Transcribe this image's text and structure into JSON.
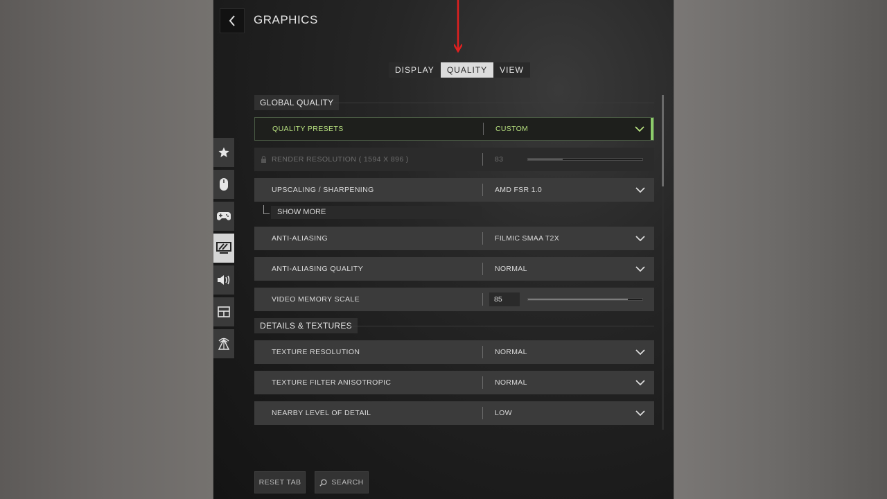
{
  "header": {
    "title": "GRAPHICS"
  },
  "tabs": [
    {
      "label": "DISPLAY",
      "active": false
    },
    {
      "label": "QUALITY",
      "active": true
    },
    {
      "label": "VIEW",
      "active": false
    }
  ],
  "sections": {
    "global": "GLOBAL QUALITY",
    "details": "DETAILS & TEXTURES"
  },
  "rows": {
    "quality_presets": {
      "label": "QUALITY PRESETS",
      "value": "CUSTOM"
    },
    "render_resolution": {
      "label": "RENDER RESOLUTION ( 1594 X 896 )",
      "value": "83",
      "level_percent": 30
    },
    "upscaling": {
      "label": "UPSCALING / SHARPENING",
      "value": "AMD FSR 1.0"
    },
    "show_more": "SHOW MORE",
    "anti_aliasing": {
      "label": "ANTI-ALIASING",
      "value": "FILMIC SMAA T2X"
    },
    "anti_aliasing_quality": {
      "label": "ANTI-ALIASING QUALITY",
      "value": "NORMAL"
    },
    "video_memory_scale": {
      "label": "VIDEO MEMORY SCALE",
      "value": "85",
      "level_percent": 87
    },
    "texture_resolution": {
      "label": "TEXTURE RESOLUTION",
      "value": "NORMAL"
    },
    "texture_filter": {
      "label": "TEXTURE FILTER ANISOTROPIC",
      "value": "NORMAL"
    },
    "nearby_lod": {
      "label": "NEARBY LEVEL OF DETAIL",
      "value": "LOW"
    }
  },
  "footer": {
    "reset": "RESET TAB",
    "search": "SEARCH"
  },
  "colors": {
    "accent_green": "#8ccc6a",
    "highlight_text": "#b7e07f",
    "arrow_red": "#e02020"
  },
  "sidebar_icons": [
    "star-icon",
    "mouse-icon",
    "gamepad-icon",
    "monitor-icon",
    "speaker-icon",
    "layout-icon",
    "network-icon"
  ]
}
